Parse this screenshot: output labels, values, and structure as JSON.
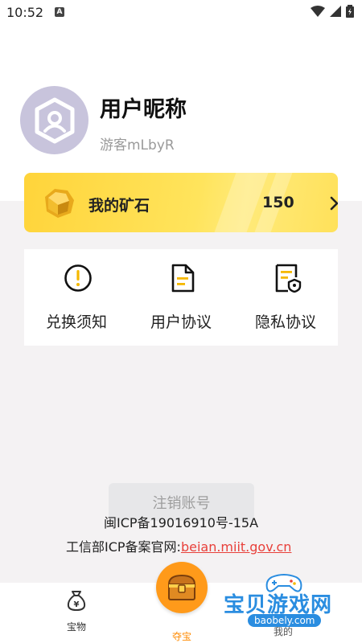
{
  "status_bar": {
    "time": "10:52",
    "notification_icon": "A"
  },
  "profile": {
    "nickname": "用户昵称",
    "guest_id": "游客mLbyR"
  },
  "ore": {
    "label": "我的矿石",
    "count": "150"
  },
  "menu": {
    "items": [
      {
        "label": "兑换须知",
        "icon": "exclamation-circle-icon"
      },
      {
        "label": "用户协议",
        "icon": "document-icon"
      },
      {
        "label": "隐私协议",
        "icon": "privacy-document-icon"
      }
    ]
  },
  "cancel_button": "注销账号",
  "icp": {
    "line1": "闽ICP备19016910号-15A",
    "line2_prefix": "工信部ICP备案官网:",
    "line2_link": "beian.miit.gov.cn"
  },
  "bottom_nav": {
    "items": [
      {
        "label": "宝物",
        "icon": "money-bag-icon"
      },
      {
        "label": "夺宝",
        "icon": "treasure-chest-icon"
      },
      {
        "label": "我的",
        "icon": "profile-icon"
      }
    ]
  },
  "watermark": {
    "title": "宝贝游戏网",
    "url": "baobely.com"
  },
  "colors": {
    "accent_yellow": "#ffd43a",
    "accent_orange": "#ff9a1a",
    "link_red": "#e8403a"
  }
}
